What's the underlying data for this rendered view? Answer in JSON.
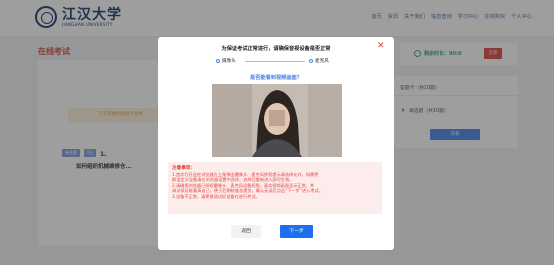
{
  "header": {
    "logo_cn": "江汉大学",
    "logo_en": "JIANGHAN UNIVERSITY",
    "nav": [
      "首页",
      "资讯",
      "关于我们",
      "信息查询",
      "学习中心",
      "在线购买",
      "个人中心"
    ]
  },
  "page": {
    "title": "在线考试",
    "notice": "下方有相机拍照不合格",
    "tag_type": "单选题",
    "tag_score": "1分",
    "question_number": "1、",
    "question_text": "如何组织机械维修仓..."
  },
  "side": {
    "timer_label": "剩余时长：90:0",
    "submit_label": "交卷",
    "answer_card_title": "答题卡（共10题）",
    "answer_item": "单选题（共10题）",
    "answer_button": "交卷"
  },
  "modal": {
    "title": "为保证考试正常进行，请确保音视设备是否正常",
    "step_camera": "摄像头",
    "step_mic": "麦克风",
    "question": "是否能看到视频画面？",
    "notes_title": "注意事项：",
    "notes_lines": [
      "1.首次打开会在浏览器左上角弹出摄像头、麦克风授权提示请选择允许，如需更",
      "换设定义设备请在浏览器设置中选择，选择后重新进入即可生效。",
      "2.请确保浏览器已授权摄像头、麦克风设备权限，真实视频画面显示正常，并",
      "调试保证能看清自己，便于后期核查及提交。确认无误后点击“下一步”进入考试。",
      "3.设备不正常，请更换测试好设备在进行考试。"
    ],
    "back_label": "返回",
    "next_label": "下一步"
  },
  "colors": {
    "accent_red": "#e0463e",
    "primary_blue": "#1e6ef0",
    "timer_green": "#3aa67a"
  },
  "icons": [
    "close-icon",
    "camera-icon",
    "microphone-icon",
    "clock-icon",
    "university-seal-icon"
  ]
}
